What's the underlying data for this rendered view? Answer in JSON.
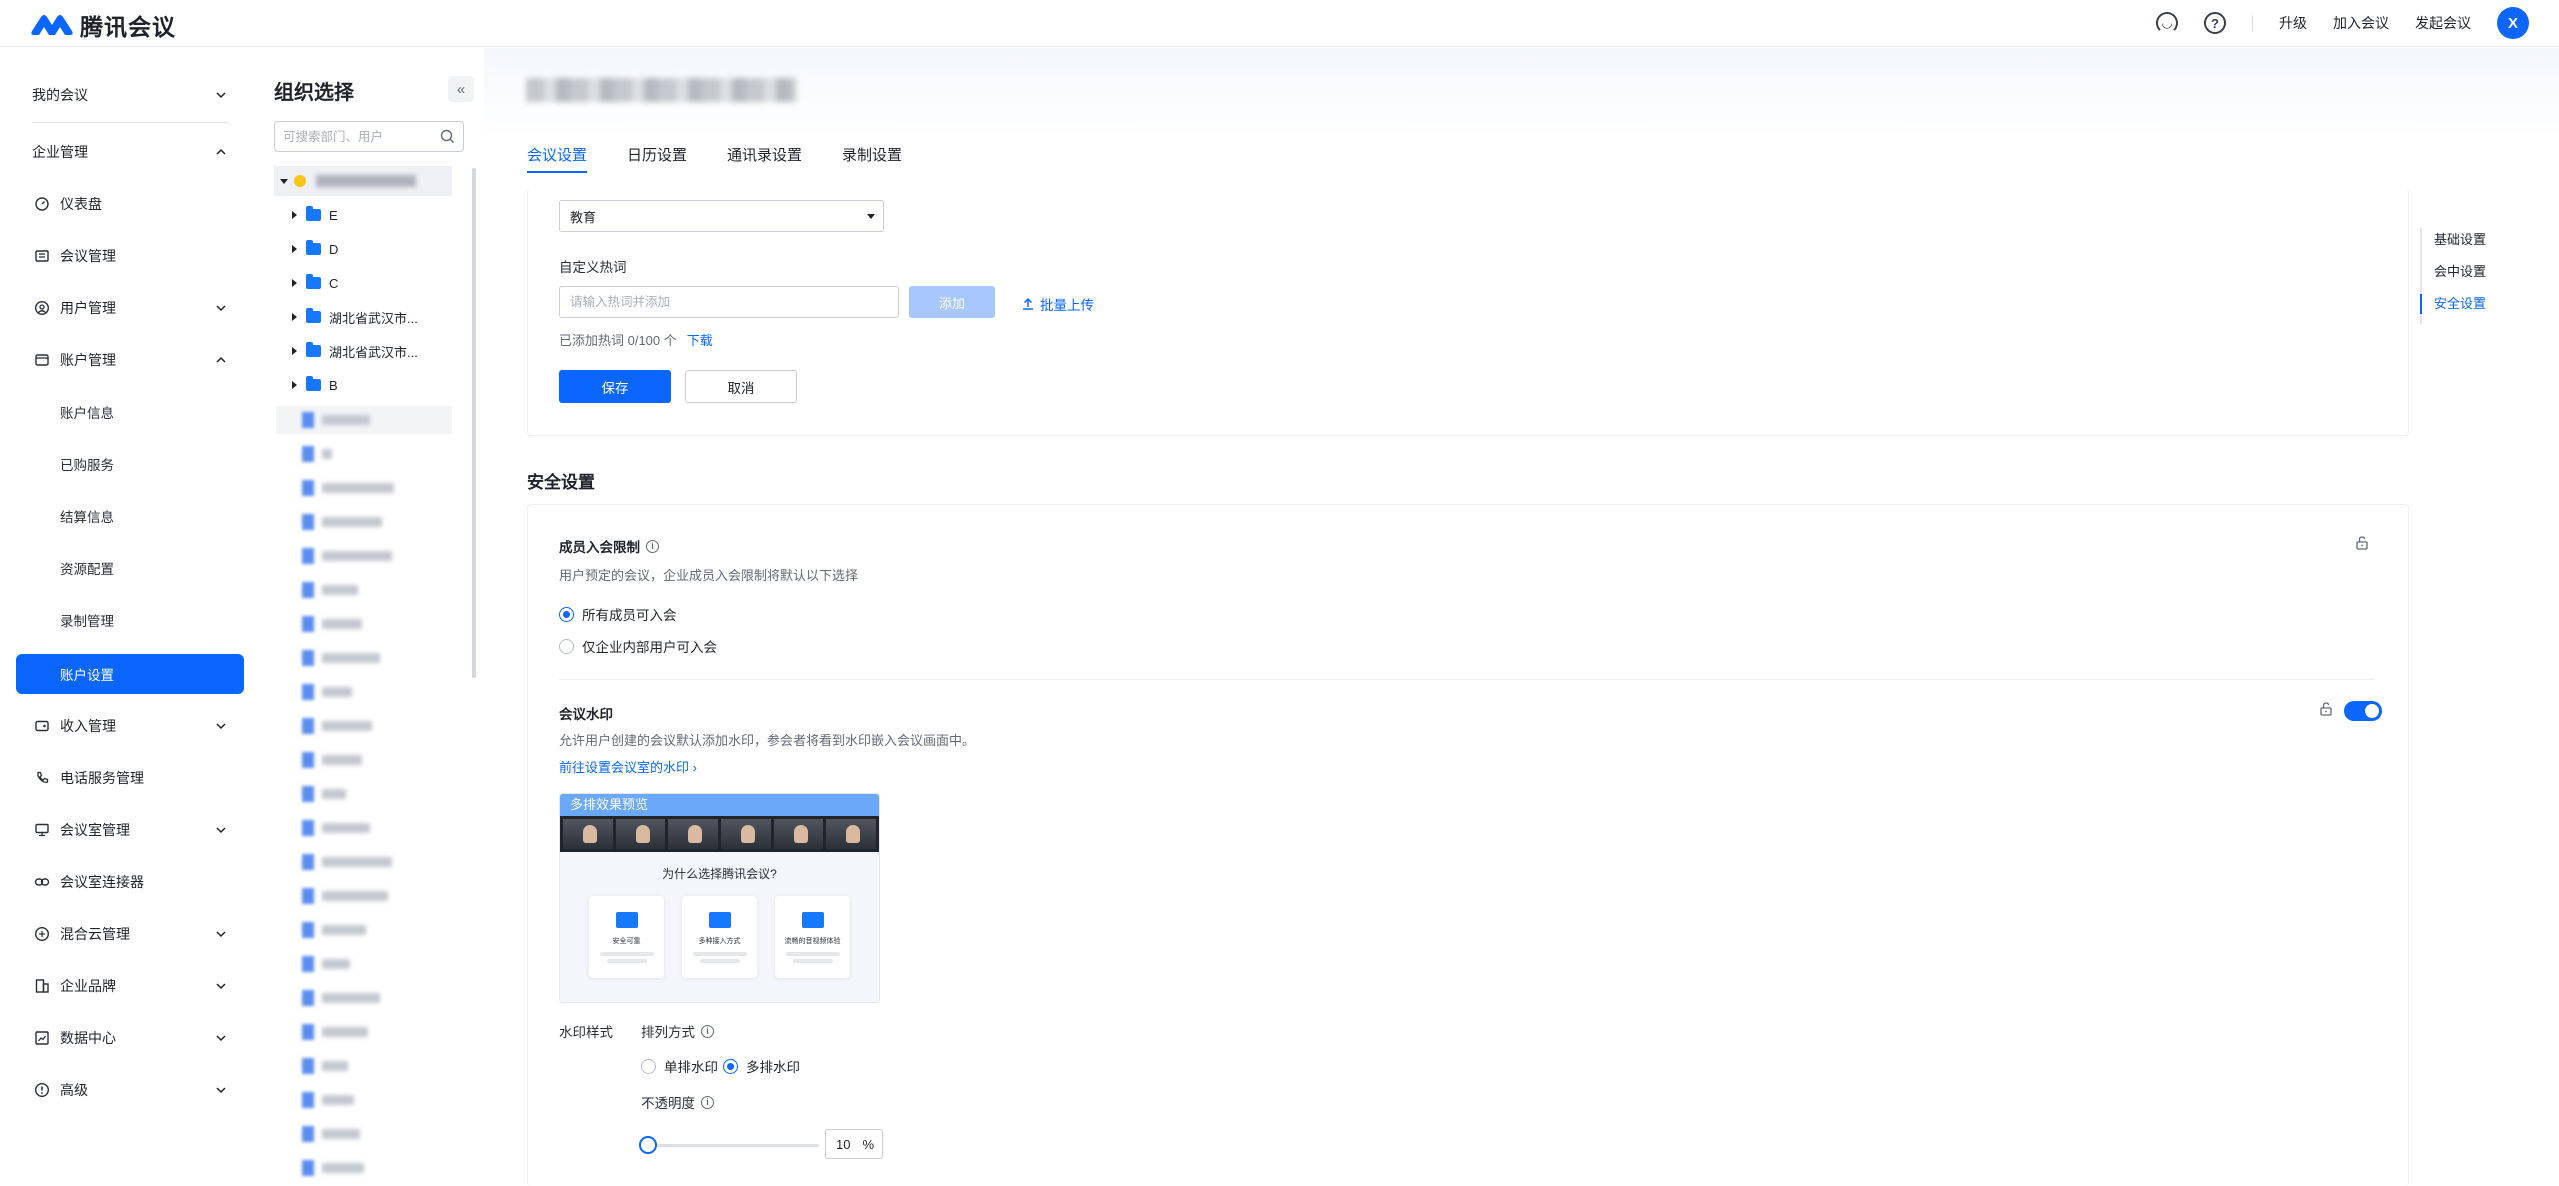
{
  "app": {
    "name": "腾讯会议"
  },
  "topbar": {
    "support_icon": "headset-icon",
    "help_icon": "question-icon",
    "upgrade": "升级",
    "join": "加入会议",
    "start": "发起会议",
    "avatar": "X"
  },
  "nav": {
    "my_meetings": "我的会议",
    "enterprise": "企业管理",
    "items": [
      {
        "label": "仪表盘",
        "icon": "dashboard-icon"
      },
      {
        "label": "会议管理",
        "icon": "list-icon"
      },
      {
        "label": "用户管理",
        "icon": "user-icon"
      },
      {
        "label": "账户管理",
        "icon": "wallet-icon"
      }
    ],
    "account_sub": [
      "账户信息",
      "已购服务",
      "结算信息",
      "资源配置",
      "录制管理",
      "账户设置"
    ],
    "more": [
      {
        "label": "收入管理",
        "icon": "income-icon"
      },
      {
        "label": "电话服务管理",
        "icon": "phone-icon"
      },
      {
        "label": "会议室管理",
        "icon": "room-icon"
      },
      {
        "label": "会议室连接器",
        "icon": "link-icon"
      },
      {
        "label": "混合云管理",
        "icon": "cloud-icon"
      },
      {
        "label": "企业品牌",
        "icon": "brand-icon"
      },
      {
        "label": "数据中心",
        "icon": "chart-icon"
      },
      {
        "label": "高级",
        "icon": "advanced-icon"
      }
    ]
  },
  "org": {
    "title": "组织选择",
    "collapse": "«",
    "search_placeholder": "可搜索部门、用户",
    "folders": [
      "E",
      "D",
      "C",
      "湖北省武汉市...",
      "湖北省武汉市...",
      "B"
    ]
  },
  "tabs": [
    "会议设置",
    "日历设置",
    "通讯录设置",
    "录制设置"
  ],
  "hotword": {
    "industry_value": "教育",
    "custom_label": "自定义热词",
    "input_placeholder": "请输入热词并添加",
    "add": "添加",
    "upload": "批量上传",
    "count_text": "已添加热词 0/100 个",
    "download": "下载",
    "save": "保存",
    "cancel": "取消"
  },
  "security": {
    "title": "安全设置",
    "join_limit": {
      "title": "成员入会限制",
      "desc": "用户预定的会议，企业成员入会限制将默认以下选择",
      "options": [
        "所有成员可入会",
        "仅企业内部用户可入会"
      ],
      "selected": 0
    },
    "watermark": {
      "title": "会议水印",
      "enabled": true,
      "desc": "允许用户创建的会议默认添加水印，参会者将看到水印嵌入会议画面中。",
      "room_link": "前往设置会议室的水印",
      "preview_title": "多排效果预览",
      "preview_question": "为什么选择腾讯会议?",
      "preview_cards": [
        "安全可靠",
        "多种接入方式",
        "流畅的音视频体验"
      ],
      "style_label": "水印样式",
      "layout_label": "排列方式",
      "layout_options": [
        "单排水印",
        "多排水印"
      ],
      "layout_selected": 1,
      "opacity_label": "不透明度",
      "opacity_value": "10",
      "opacity_unit": "%",
      "opacity_fraction": 0.1
    }
  },
  "anchor": [
    "基础设置",
    "会中设置",
    "安全设置"
  ],
  "colors": {
    "primary": "#0a66ff",
    "brand": "#0a66ff"
  }
}
